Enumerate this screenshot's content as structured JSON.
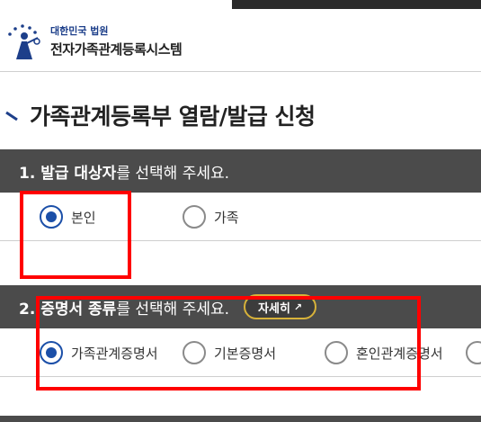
{
  "header": {
    "court_name": "대한민국 법원",
    "system_name": "전자가족관계등록시스템"
  },
  "page_title": "가족관계등록부 열람/발급 신청",
  "section1": {
    "title_bold": "1. 발급 대상자",
    "title_rest": "를 선택해 주세요.",
    "options": [
      {
        "label": "본인",
        "checked": true
      },
      {
        "label": "가족",
        "checked": false
      }
    ]
  },
  "section2": {
    "title_bold": "2. 증명서 종류",
    "title_rest": "를 선택해 주세요.",
    "detail_button": "자세히",
    "options": [
      {
        "label": "가족관계증명서",
        "checked": true
      },
      {
        "label": "기본증명서",
        "checked": false
      },
      {
        "label": "혼인관계증명서",
        "checked": false
      }
    ]
  },
  "colors": {
    "accent": "#1b4fa8",
    "section_header": "#4b4b4b",
    "highlight": "#ff0000",
    "detail_border": "#d7b23a"
  },
  "icons": [
    "court-logo-icon",
    "title-deco-icon",
    "external-link-icon"
  ]
}
